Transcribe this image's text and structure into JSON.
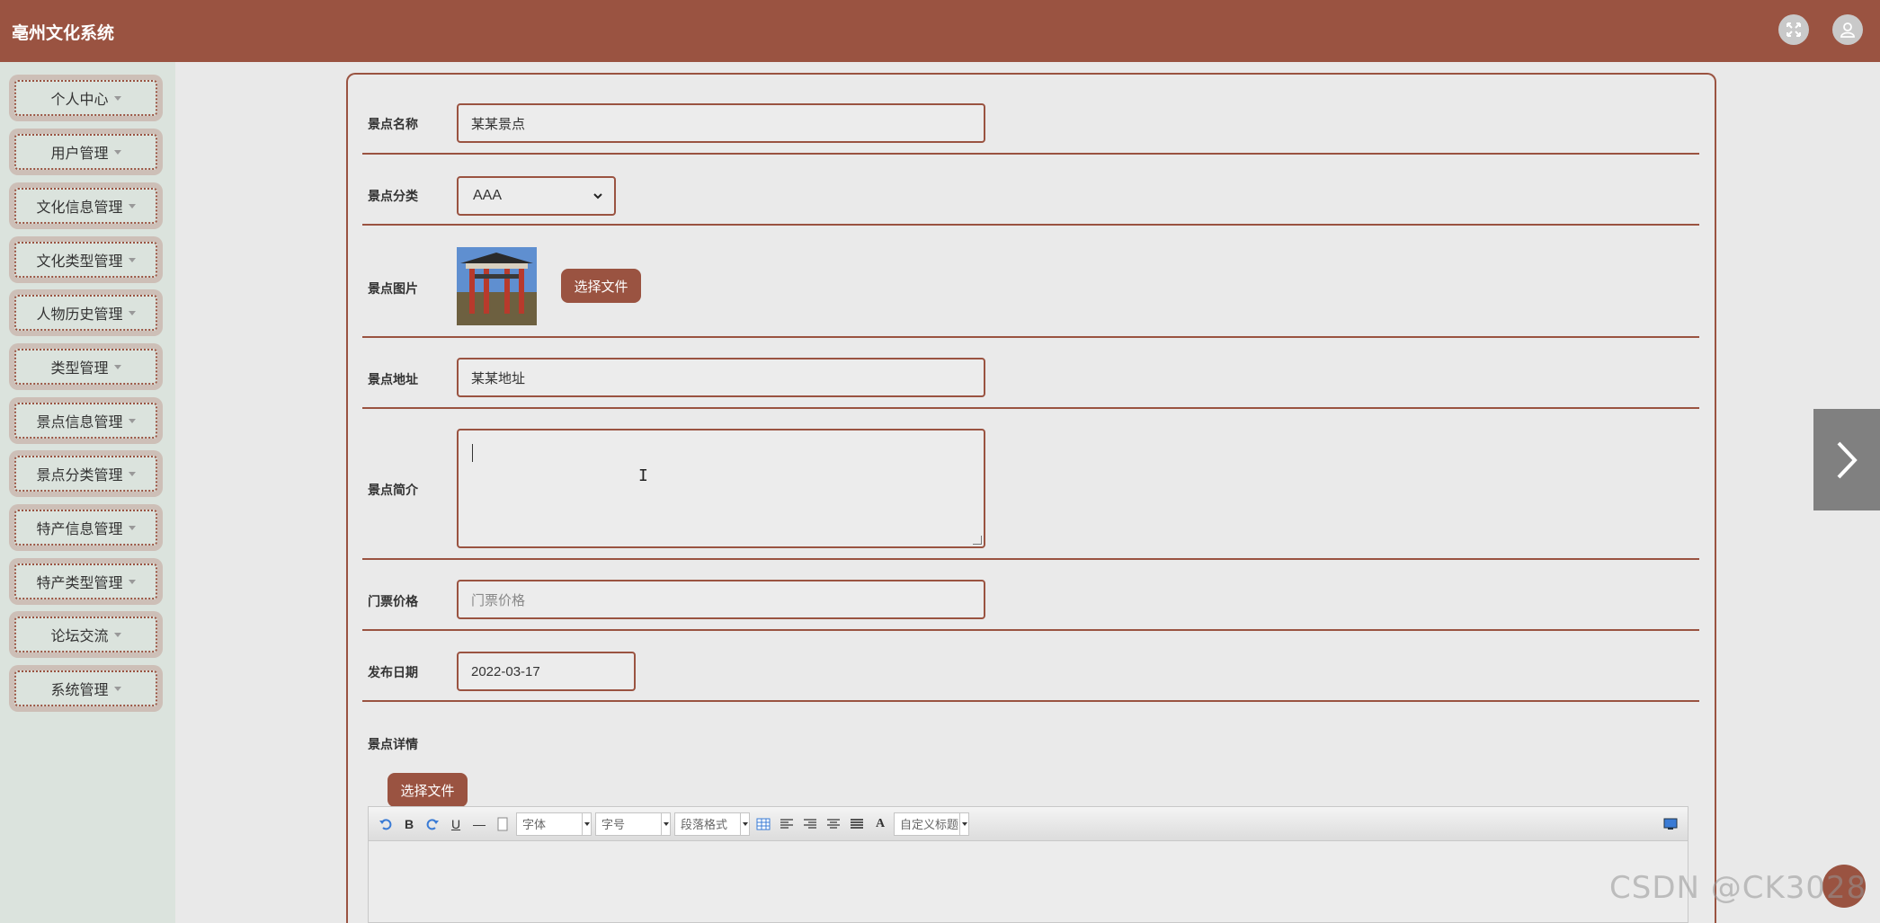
{
  "app": {
    "title": "亳州文化系统"
  },
  "sidebar": {
    "items": [
      {
        "label": "个人中心"
      },
      {
        "label": "用户管理"
      },
      {
        "label": "文化信息管理"
      },
      {
        "label": "文化类型管理"
      },
      {
        "label": "人物历史管理"
      },
      {
        "label": "类型管理"
      },
      {
        "label": "景点信息管理"
      },
      {
        "label": "景点分类管理"
      },
      {
        "label": "特产信息管理"
      },
      {
        "label": "特产类型管理"
      },
      {
        "label": "论坛交流"
      },
      {
        "label": "系统管理"
      }
    ]
  },
  "form": {
    "name": {
      "label": "景点名称",
      "value": "某某景点"
    },
    "category": {
      "label": "景点分类",
      "value": "AAA"
    },
    "image": {
      "label": "景点图片",
      "button": "选择文件"
    },
    "address": {
      "label": "景点地址",
      "value": "某某地址"
    },
    "intro": {
      "label": "景点简介",
      "value": ""
    },
    "price": {
      "label": "门票价格",
      "placeholder": "门票价格"
    },
    "date": {
      "label": "发布日期",
      "value": "2022-03-17"
    },
    "detail": {
      "label": "景点详情",
      "button": "选择文件"
    }
  },
  "editor": {
    "font_family": "字体",
    "font_size": "字号",
    "paragraph": "段落格式",
    "custom_title": "自定义标题",
    "bold": "B",
    "underline": "U",
    "hr": "—",
    "font_color": "A"
  },
  "watermark": "CSDN @CK3028",
  "colors": {
    "accent": "#9a5341",
    "sidebar": "#dbe3dd",
    "background": "#e9e9e9"
  }
}
